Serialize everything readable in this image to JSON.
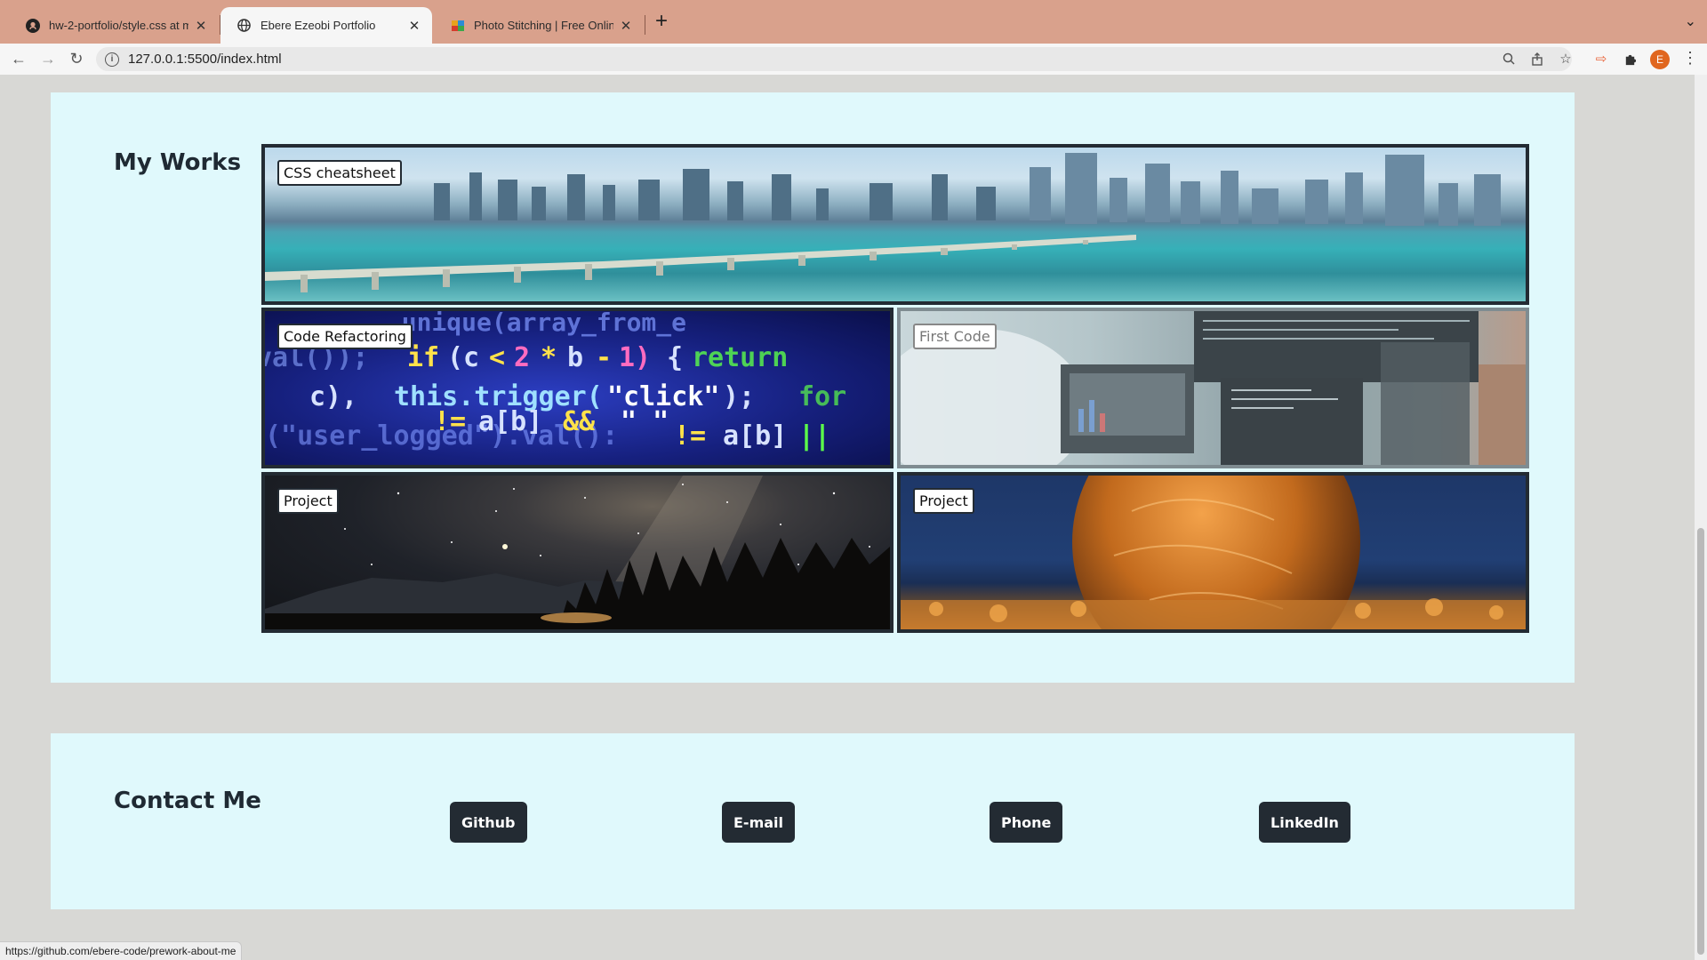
{
  "browser": {
    "tabs": [
      {
        "title": "hw-2-portfolio/style.css at mai",
        "icon": "github-icon"
      },
      {
        "title": "Ebere Ezeobi Portfolio",
        "icon": "globe-icon"
      },
      {
        "title": "Photo Stitching | Free Online Ph",
        "icon": "photo-stitching-icon"
      }
    ],
    "new_tab": "+",
    "url": "127.0.0.1:5500/index.html",
    "profile_initial": "E"
  },
  "works": {
    "title": "My Works",
    "projects": [
      {
        "label": "CSS cheatsheet"
      },
      {
        "label": "Code Refactoring"
      },
      {
        "label": "First Code"
      },
      {
        "label": "Project"
      },
      {
        "label": "Project"
      }
    ]
  },
  "contact": {
    "title": "Contact Me",
    "buttons": [
      {
        "label": "Github"
      },
      {
        "label": "E-mail"
      },
      {
        "label": "Phone"
      },
      {
        "label": "LinkedIn"
      }
    ]
  },
  "status_url": "https://github.com/ebere-code/prework-about-me",
  "colors": {
    "page_bg": "#d8d8d5",
    "section_bg": "#e0f9fc",
    "dark": "#232b33",
    "tabstrip": "#d9a18c"
  }
}
